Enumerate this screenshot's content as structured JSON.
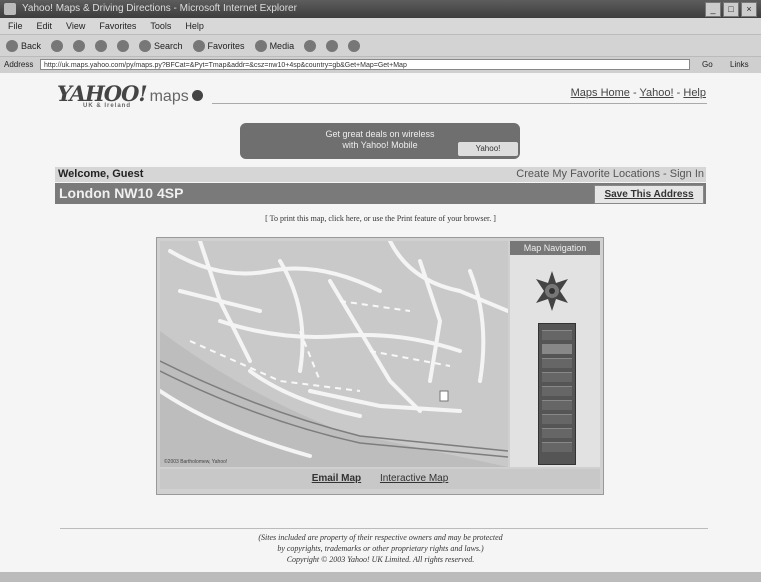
{
  "browser": {
    "title": "Yahoo! Maps & Driving Directions - Microsoft Internet Explorer",
    "menu": [
      "File",
      "Edit",
      "View",
      "Favorites",
      "Tools",
      "Help"
    ],
    "toolbar": [
      "Back",
      "Search",
      "Favorites",
      "Media"
    ],
    "address_label": "Address",
    "url": "http://uk.maps.yahoo.com/py/maps.py?BFCat=&Pyt=Tmap&addr=&csz=nw10+4sp&country=gb&Get+Map=Get+Map",
    "go_label": "Go",
    "links_label": "Links"
  },
  "header": {
    "logo_text": "YAHOO!",
    "logo_maps": "maps",
    "logo_sub": "UK & Ireland",
    "links": [
      "Maps Home",
      "Yahoo!",
      "Help"
    ],
    "separator": "-"
  },
  "banner": {
    "line1": "Get great deals on wireless",
    "line2": "with Yahoo! Mobile",
    "button": "Yahoo!"
  },
  "welcome": {
    "greeting": "Welcome, Guest",
    "right": "Create My Favorite Locations - Sign In"
  },
  "address": {
    "title": "London NW10 4SP",
    "save_button": "Save This Address"
  },
  "print_note": "[ To print this map, click here, or use the Print feature of your browser. ]",
  "map": {
    "copyright": "©2003 Bartholomew, Yahoo!",
    "nav_title": "Map Navigation",
    "tabs": {
      "active": "Email Map",
      "other": "Interactive Map"
    }
  },
  "footer": {
    "line1": "(Sites included are property of their respective owners and may be protected",
    "line2": "by copyrights, trademarks or other proprietary rights and laws.)",
    "line3": "Copyright © 2003 Yahoo! UK Limited. All rights reserved."
  }
}
